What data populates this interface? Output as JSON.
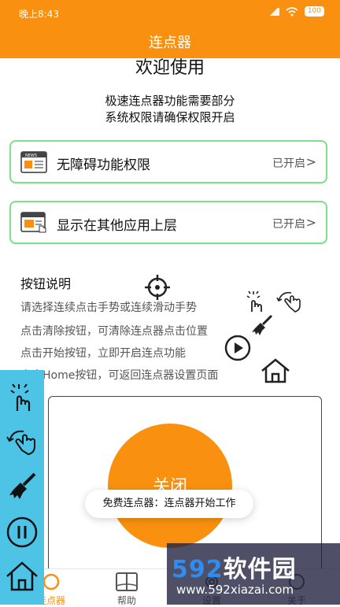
{
  "status_bar": {
    "time": "晚上8:43",
    "battery": "100"
  },
  "app_bar": {
    "title": "连点器"
  },
  "welcome": "欢迎使用",
  "intro": {
    "line1": "极速连点器功能需要部分",
    "line2": "系统权限请确保权限开启"
  },
  "permissions": [
    {
      "label": "无障碍功能权限",
      "status": "已开启",
      "icon": "news-icon"
    },
    {
      "label": "显示在其他应用上层",
      "status": "已开启",
      "icon": "window-hand-icon"
    }
  ],
  "button_guide": {
    "title": "按钮说明",
    "lines": [
      "请选择连续点击手势或连续滑动手势",
      "点击清除按钮，可清除连点器点击位置",
      "点击开始按钮，立即开启连点功能",
      "点击Home按钮，可返回连点器设置页面"
    ]
  },
  "main_button": {
    "label": "关闭"
  },
  "toast": "免费连点器：连点器开始工作",
  "tabs": [
    {
      "label": "连点器",
      "icon": "home-tab-icon"
    },
    {
      "label": "帮助",
      "icon": "book-icon"
    },
    {
      "label": "设置",
      "icon": "gear-icon"
    },
    {
      "label": "关于",
      "icon": "info-icon"
    }
  ],
  "watermark": {
    "brand_num": "592",
    "brand_text": "软件园",
    "url": "www.592xiazai.com"
  },
  "colors": {
    "accent": "#F9900F",
    "float": "#4DC3E6",
    "card_border": "#7ee08a"
  }
}
